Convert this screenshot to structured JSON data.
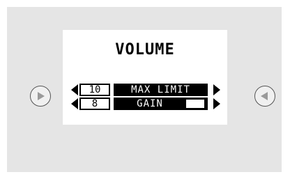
{
  "screen": {
    "title": "VOLUME",
    "rows": [
      {
        "value": "10",
        "label": "MAX LIMIT"
      },
      {
        "value": "8",
        "label": "GAIN"
      }
    ]
  },
  "icons": {
    "left_nav": "play-right-icon",
    "right_nav": "play-left-icon",
    "row_left": "triangle-left-icon",
    "row_right": "triangle-right-icon"
  },
  "colors": {
    "panel": "#e5e5e5",
    "screen": "#ffffff",
    "label_bar": "#000000",
    "nav_icon": "#9a9a9a"
  }
}
